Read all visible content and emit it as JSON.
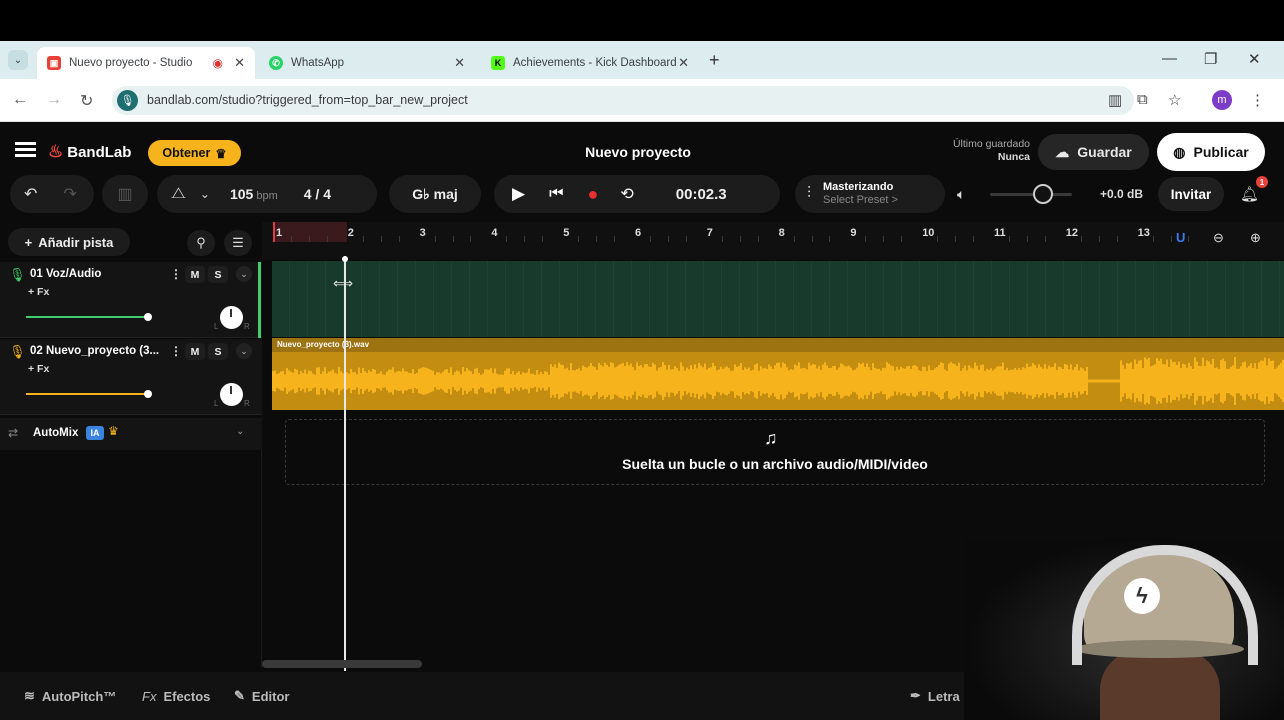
{
  "browser": {
    "tabs": [
      {
        "label": "Nuevo proyecto - Studio",
        "favicon_color": "#e8413a"
      },
      {
        "label": "WhatsApp",
        "favicon_color": "#25d366"
      },
      {
        "label": "Achievements - Kick Dashboard",
        "favicon_color": "#53fc18",
        "favicon_letter": "K"
      }
    ],
    "url": "bandlab.com/studio?triggered_from=top_bar_new_project",
    "profile_initial": "m"
  },
  "app": {
    "brand": "BandLab",
    "obtener_label": "Obtener",
    "project_title": "Nuevo proyecto",
    "last_saved_label": "Último guardado",
    "last_saved_value": "Nunca",
    "save_label": "Guardar",
    "publish_label": "Publicar",
    "bpm_value": "105",
    "bpm_unit": "bpm",
    "time_signature": "4 / 4",
    "key": "G♭ maj",
    "timecode": "00:02.3",
    "mastering_label": "Masterizando",
    "mastering_preset": "Select Preset >",
    "output_gain": "+0.0 dB",
    "invite_label": "Invitar",
    "notifications_count": "1",
    "master_volume_level": 0.65
  },
  "left_panel": {
    "add_track_label": "Añadir pista",
    "tracks": [
      {
        "name": "01  Voz/Audio",
        "fx": "+ Fx",
        "mute": "M",
        "solo": "S",
        "color": "#3fcf6e",
        "volume_level": 1.0
      },
      {
        "name": "02  Nuevo_proyecto (3...",
        "fx": "+ Fx",
        "mute": "M",
        "solo": "S",
        "color": "#f6b31b",
        "volume_level": 1.0
      }
    ],
    "automix": {
      "label": "AutoMix",
      "badge": "IA"
    },
    "pan_left": "L",
    "pan_right": "R"
  },
  "timeline": {
    "bars": [
      "1",
      "2",
      "3",
      "4",
      "5",
      "6",
      "7",
      "8",
      "9",
      "10",
      "11",
      "12",
      "13"
    ],
    "clip_name": "Nuevo_proyecto (3).wav",
    "drop_text": "Suelta un bucle o un archivo audio/MIDI/video"
  },
  "bottom_bar": {
    "autopitch_label": "AutoPitch™",
    "effects_label": "Efectos",
    "effects_prefix": "Fx",
    "editor_label": "Editor",
    "lyrics_label": "Letra"
  }
}
